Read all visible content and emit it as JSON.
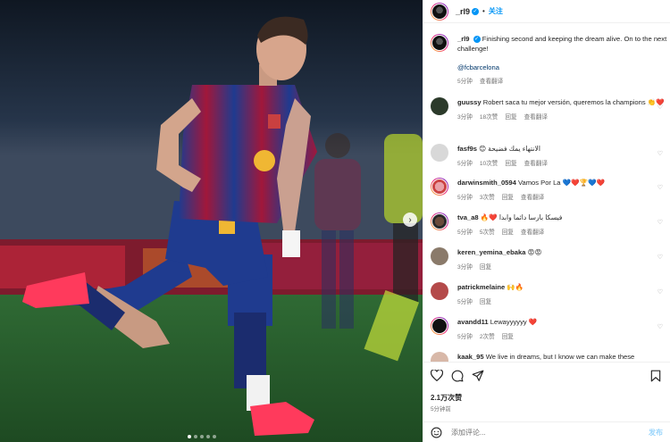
{
  "header": {
    "username": "_rl9",
    "separator": "•",
    "follow_label": "关注"
  },
  "post": {
    "username": "_rl9",
    "caption": "Finishing second and keeping the dream alive. On to the next challenge!",
    "tag": "@fcbarcelona",
    "time": "5分钟",
    "translate": "查看翻译"
  },
  "comments": [
    {
      "user": "guussy",
      "text": "Robert saca tu mejor versión, queremos la champions",
      "emoji": "👏❤️",
      "time": "3分钟",
      "likes": "18次赞",
      "reply": "回复",
      "translate": "查看翻译"
    },
    {
      "user": "fasf9s",
      "text": "😊 الانتهاء يمك فضيحة",
      "emoji": "",
      "time": "5分钟",
      "likes": "10次赞",
      "reply": "回复",
      "translate": "查看翻译"
    },
    {
      "user": "darwinsmith_0594",
      "text": "Vamos Por La",
      "emoji": "💙❤️🏆💙❤️",
      "time": "5分钟",
      "likes": "3次赞",
      "reply": "回复",
      "translate": "查看翻译"
    },
    {
      "user": "tva_a8",
      "text": "🔥❤️ فيسكا بارسا دائما وابدا",
      "emoji": "",
      "time": "5分钟",
      "likes": "5次赞",
      "reply": "回复",
      "translate": "查看翻译"
    },
    {
      "user": "keren_yemina_ebaka",
      "text": "😡😡",
      "emoji": "",
      "time": "3分钟",
      "likes": "",
      "reply": "回复",
      "translate": ""
    },
    {
      "user": "patrickmelaine",
      "text": "🙌🔥",
      "emoji": "",
      "time": "5分钟",
      "likes": "",
      "reply": "回复",
      "translate": ""
    },
    {
      "user": "avandd11",
      "text": "Lewayyyyyy",
      "emoji": "❤️",
      "time": "5分钟",
      "likes": "2次赞",
      "reply": "回复",
      "translate": ""
    },
    {
      "user": "kaak_95",
      "text": "We live in dreams, but I know we can make these",
      "emoji": "",
      "time": "",
      "likes": "",
      "reply": "",
      "translate": ""
    }
  ],
  "footer": {
    "likes": "2.1万次赞",
    "time": "5分钟前",
    "comment_placeholder": "添加评论...",
    "post_label": "发布"
  },
  "colors": {
    "accent": "#0095f6",
    "barca_blue": "#1f3b8f",
    "barca_red": "#a1173a"
  }
}
